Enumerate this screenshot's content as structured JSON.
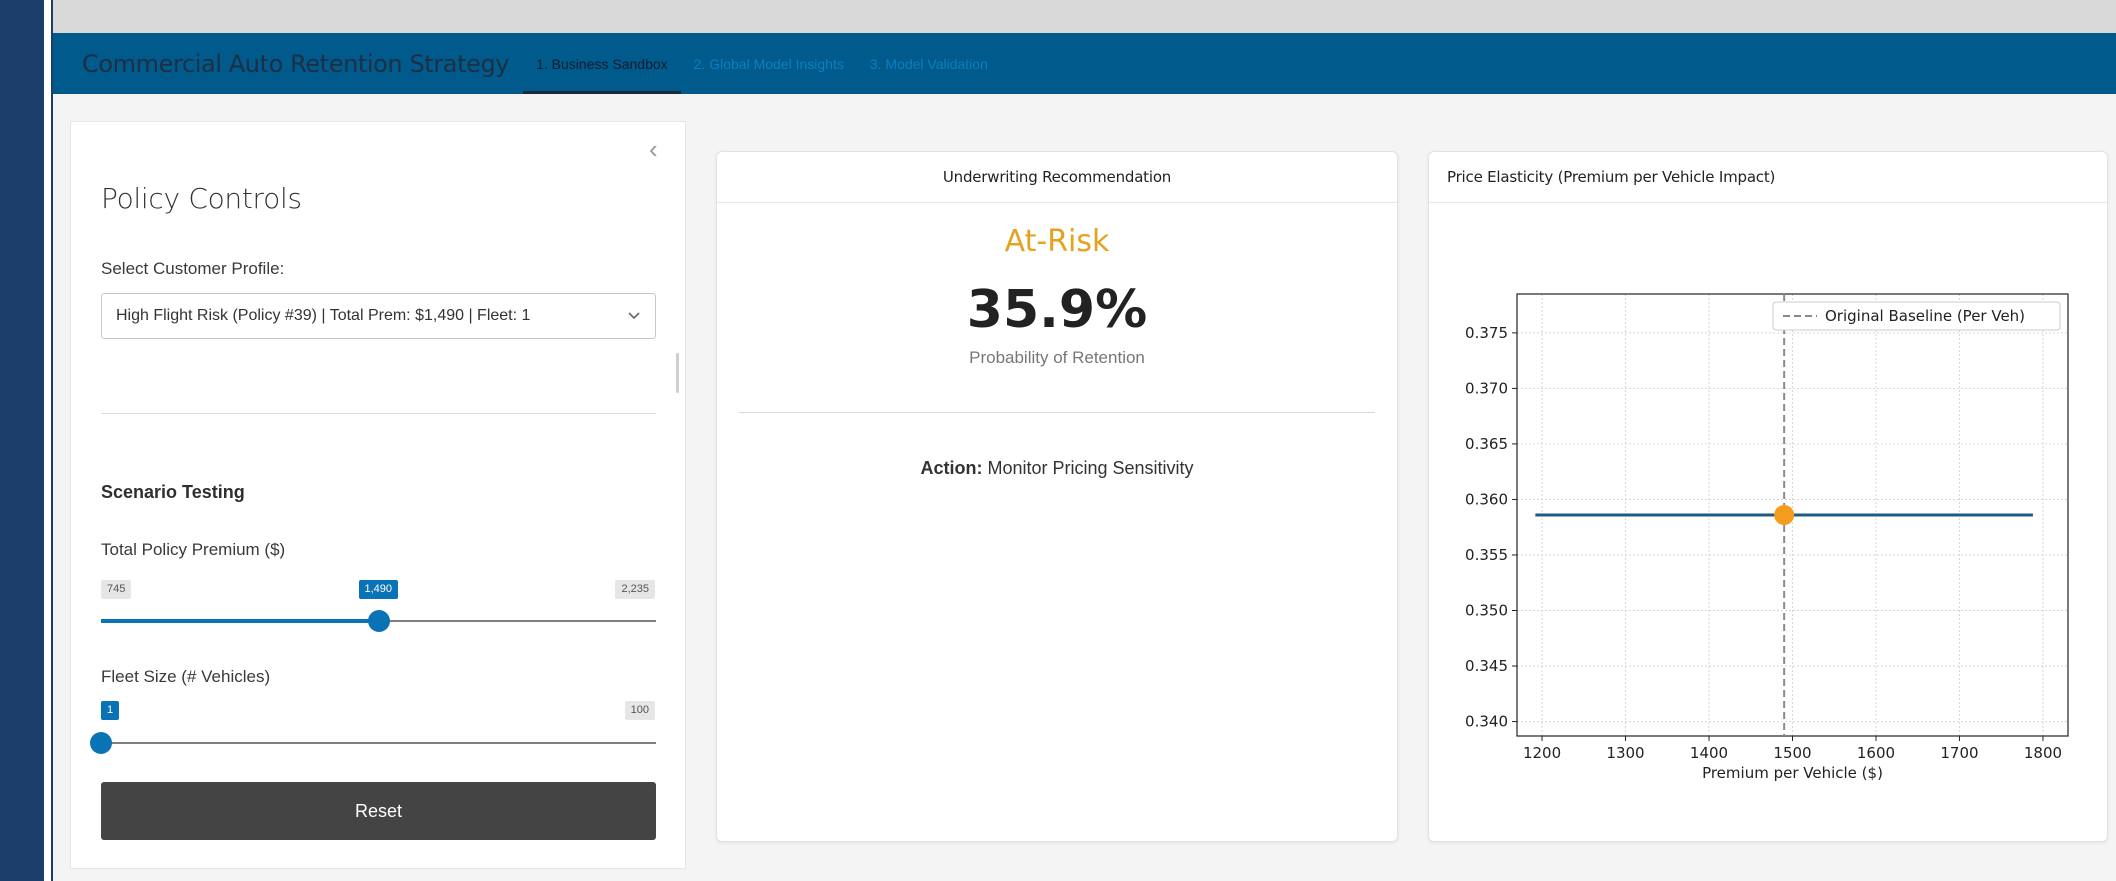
{
  "app": {
    "title": "Commercial Auto Retention Strategy",
    "tabs": [
      {
        "label": "1. Business Sandbox",
        "active": true
      },
      {
        "label": "2. Global Model Insights",
        "active": false
      },
      {
        "label": "3. Model Validation",
        "active": false
      }
    ]
  },
  "sidebar": {
    "collapse_icon": "‹",
    "title": "Policy Controls",
    "profile_label": "Select Customer Profile:",
    "profile_value": "High Flight Risk (Policy #39) | Total Prem: $1,490 | Fleet: 1",
    "scenario_title": "Scenario Testing",
    "premium_slider": {
      "label": "Total Policy Premium ($)",
      "min_label": "745",
      "max_label": "2,235",
      "value_label": "1,490",
      "min": 745,
      "max": 2235,
      "value": 1490
    },
    "fleet_slider": {
      "label": "Fleet Size (# Vehicles)",
      "min_label": "1",
      "max_label": "100",
      "min": 1,
      "max": 100,
      "value": 1
    },
    "reset_label": "Reset"
  },
  "recommendation": {
    "header": "Underwriting Recommendation",
    "status": "At-Risk",
    "status_color": "#e5a21f",
    "probability": "35.9%",
    "probability_label": "Probability of Retention",
    "action_prefix": "Action:",
    "action_text": "Monitor Pricing Sensitivity"
  },
  "elasticity": {
    "header": "Price Elasticity (Premium per Vehicle Impact)"
  },
  "chart_data": {
    "type": "line",
    "title": "",
    "xlabel": "Premium per Vehicle ($)",
    "ylabel": "",
    "xlim": [
      1170,
      1830
    ],
    "ylim": [
      0.3387,
      0.3785
    ],
    "x_ticks": [
      1200,
      1300,
      1400,
      1500,
      1600,
      1700,
      1800
    ],
    "y_ticks": [
      0.34,
      0.345,
      0.35,
      0.355,
      0.36,
      0.365,
      0.37,
      0.375
    ],
    "grid": true,
    "legend_position": "top-right",
    "series": [
      {
        "x": [
          1192,
          1490,
          1788
        ],
        "y": [
          0.3586,
          0.3586,
          0.3586
        ],
        "color": "#1d5b82"
      }
    ],
    "marker": {
      "x": 1490,
      "y": 0.3586,
      "color": "#f39c1e"
    },
    "baseline": {
      "name": "Original Baseline (Per Veh)",
      "x": 1490,
      "color": "#8a8a8a"
    }
  }
}
